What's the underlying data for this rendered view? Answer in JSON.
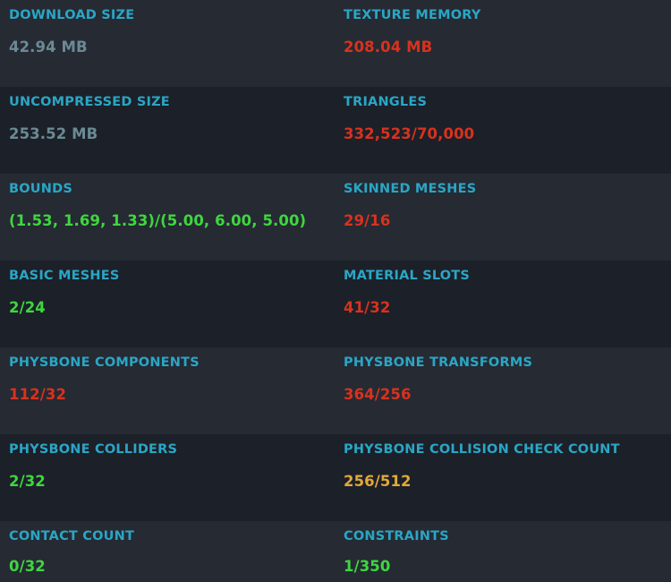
{
  "colors": {
    "label": "#2aa6c5",
    "neutral": "#6b8a94",
    "good": "#3fd63f",
    "bad": "#d8321e",
    "warn": "#e0a93a",
    "row_bg_a": "#252a33",
    "row_bg_b": "#1c2029"
  },
  "stats": [
    {
      "left": {
        "label": "DOWNLOAD SIZE",
        "value": "42.94 MB",
        "status": "neutral"
      },
      "right": {
        "label": "TEXTURE MEMORY",
        "value": "208.04 MB",
        "status": "bad"
      }
    },
    {
      "left": {
        "label": "UNCOMPRESSED SIZE",
        "value": "253.52 MB",
        "status": "neutral"
      },
      "right": {
        "label": "TRIANGLES",
        "value": "332,523/70,000",
        "status": "bad"
      }
    },
    {
      "left": {
        "label": "BOUNDS",
        "value": "(1.53, 1.69, 1.33)/(5.00, 6.00, 5.00)",
        "status": "good"
      },
      "right": {
        "label": "SKINNED MESHES",
        "value": "29/16",
        "status": "bad"
      }
    },
    {
      "left": {
        "label": "BASIC MESHES",
        "value": "2/24",
        "status": "good"
      },
      "right": {
        "label": "MATERIAL SLOTS",
        "value": "41/32",
        "status": "bad"
      }
    },
    {
      "left": {
        "label": "PHYSBONE COMPONENTS",
        "value": "112/32",
        "status": "bad"
      },
      "right": {
        "label": "PHYSBONE TRANSFORMS",
        "value": "364/256",
        "status": "bad"
      }
    },
    {
      "left": {
        "label": "PHYSBONE COLLIDERS",
        "value": "2/32",
        "status": "good"
      },
      "right": {
        "label": "PHYSBONE COLLISION CHECK COUNT",
        "value": "256/512",
        "status": "warn"
      }
    },
    {
      "left": {
        "label": "CONTACT COUNT",
        "value": "0/32",
        "status": "good"
      },
      "right": {
        "label": "CONSTRAINTS",
        "value": "1/350",
        "status": "good"
      }
    }
  ]
}
